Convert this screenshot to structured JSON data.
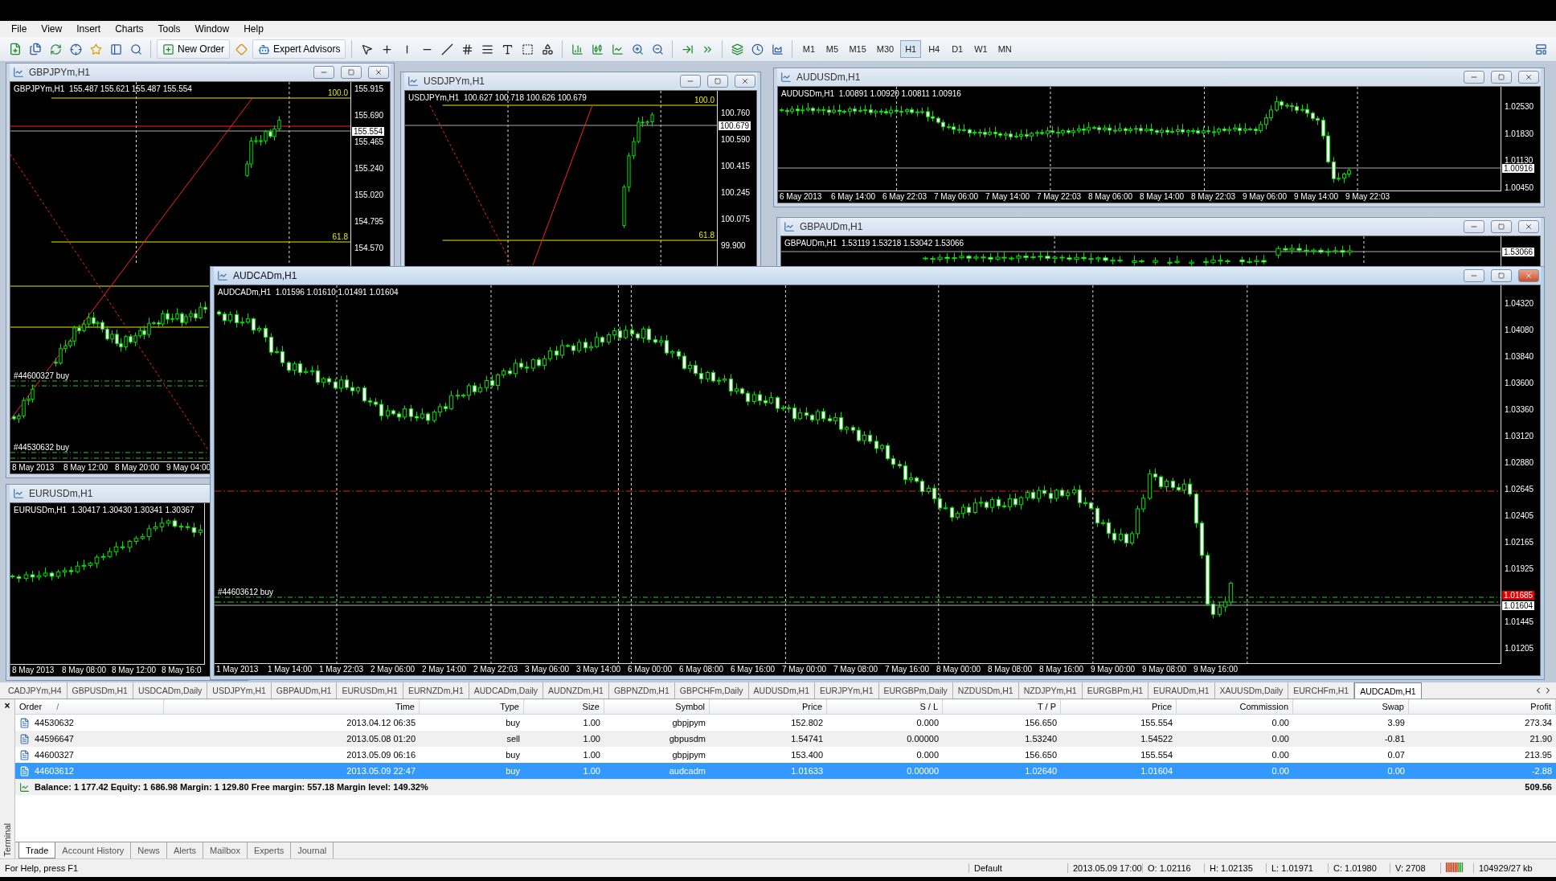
{
  "menu": [
    "File",
    "View",
    "Insert",
    "Charts",
    "Tools",
    "Window",
    "Help"
  ],
  "toolbar": {
    "buttons": [
      "New Order",
      "Expert Advisors"
    ],
    "timeframes": [
      {
        "label": "M1",
        "selected": false
      },
      {
        "label": "M5",
        "selected": false
      },
      {
        "label": "M15",
        "selected": false
      },
      {
        "label": "M30",
        "selected": false
      },
      {
        "label": "H1",
        "selected": true
      },
      {
        "label": "H4",
        "selected": false
      },
      {
        "label": "D1",
        "selected": false
      },
      {
        "label": "W1",
        "selected": false
      },
      {
        "label": "MN",
        "selected": false
      }
    ]
  },
  "windows": [
    {
      "title": "GBPJPYm,H1",
      "active": false,
      "header": "GBPJPYm,H1  155.487 155.621 155.487 155.554",
      "y_labels": [
        {
          "text": "155.915",
          "kind": "tick"
        },
        {
          "text": "155.690",
          "kind": "tick"
        },
        {
          "text": "155.554",
          "kind": "current"
        },
        {
          "text": "155.465",
          "kind": "tick"
        },
        {
          "text": "155.240",
          "kind": "tick"
        },
        {
          "text": "155.020",
          "kind": "tick"
        },
        {
          "text": "154.795",
          "kind": "tick"
        },
        {
          "text": "154.570",
          "kind": "tick"
        }
      ],
      "x_labels": [
        "8 May 2013",
        "8 May 12:00",
        "8 May 20:00",
        "9 May 04:00"
      ],
      "marks": [
        {
          "kind": "fib",
          "label": "100.0"
        },
        {
          "kind": "fib",
          "label": "61.8"
        },
        {
          "kind": "trade",
          "label": "#44600327 buy"
        },
        {
          "kind": "trade",
          "label": "#44530632 buy"
        }
      ]
    },
    {
      "title": "USDJPYm,H1",
      "active": false,
      "header": "USDJPYm,H1  100.627 100.718 100.626 100.679",
      "y_labels": [
        {
          "text": "100.760",
          "kind": "tick"
        },
        {
          "text": "100.679",
          "kind": "current"
        },
        {
          "text": "100.590",
          "kind": "tick"
        },
        {
          "text": "100.415",
          "kind": "tick"
        },
        {
          "text": "100.245",
          "kind": "tick"
        },
        {
          "text": "100.075",
          "kind": "tick"
        },
        {
          "text": "99.900",
          "kind": "tick"
        }
      ],
      "marks": [
        {
          "kind": "fib",
          "label": "100.0"
        },
        {
          "kind": "fib",
          "label": "61.8"
        }
      ]
    },
    {
      "title": "AUDUSDm,H1",
      "active": false,
      "header": "AUDUSDm,H1  1.00891 1.00920 1.00811 1.00916",
      "y_labels": [
        {
          "text": "1.02530",
          "kind": "tick"
        },
        {
          "text": "1.01830",
          "kind": "tick"
        },
        {
          "text": "1.01130",
          "kind": "tick"
        },
        {
          "text": "1.00916",
          "kind": "current"
        },
        {
          "text": "1.00450",
          "kind": "tick"
        }
      ],
      "x_labels": [
        "6 May 2013",
        "6 May 14:00",
        "6 May 22:03",
        "7 May 06:00",
        "7 May 14:00",
        "7 May 22:03",
        "8 May 06:00",
        "8 May 14:00",
        "8 May 22:03",
        "9 May 06:00",
        "9 May 14:00",
        "9 May 22:03"
      ]
    },
    {
      "title": "GBPAUDm,H1",
      "active": false,
      "header": "GBPAUDm,H1  1.53119 1.53218 1.53042 1.53066",
      "y_labels": [
        {
          "text": "1.53066",
          "kind": "current"
        }
      ]
    },
    {
      "title": "EURUSDm,H1",
      "active": false,
      "header": "EURUSDm,H1  1.30417 1.30430 1.30341 1.30367",
      "x_labels": [
        "8 May 2013",
        "8 May 08:00",
        "8 May 12:00",
        "8 May 16:0"
      ]
    },
    {
      "title": "AUDCADm,H1",
      "active": true,
      "header": "AUDCADm,H1  1.01596 1.01610 1.01491 1.01604",
      "y_labels": [
        {
          "text": "1.04320",
          "kind": "tick"
        },
        {
          "text": "1.04080",
          "kind": "tick"
        },
        {
          "text": "1.03840",
          "kind": "tick"
        },
        {
          "text": "1.03600",
          "kind": "tick"
        },
        {
          "text": "1.03360",
          "kind": "tick"
        },
        {
          "text": "1.03120",
          "kind": "tick"
        },
        {
          "text": "1.02880",
          "kind": "tick"
        },
        {
          "text": "1.02645",
          "kind": "tick"
        },
        {
          "text": "1.02405",
          "kind": "tick"
        },
        {
          "text": "1.02165",
          "kind": "tick"
        },
        {
          "text": "1.01925",
          "kind": "tick"
        },
        {
          "text": "1.01685",
          "kind": "stop"
        },
        {
          "text": "1.01604",
          "kind": "current"
        },
        {
          "text": "1.01445",
          "kind": "tick"
        },
        {
          "text": "1.01205",
          "kind": "tick"
        }
      ],
      "x_labels": [
        "1 May 2013",
        "1 May 14:00",
        "1 May 22:03",
        "2 May 06:00",
        "2 May 14:00",
        "2 May 22:03",
        "3 May 06:00",
        "3 May 14:00",
        "6 May 00:00",
        "6 May 08:00",
        "6 May 16:00",
        "7 May 00:00",
        "7 May 08:00",
        "7 May 16:00",
        "8 May 00:00",
        "8 May 08:00",
        "8 May 16:00",
        "9 May 00:00",
        "9 May 08:00",
        "9 May 16:00"
      ],
      "marks": [
        {
          "kind": "trade",
          "label": "#44603612 buy"
        }
      ]
    }
  ],
  "chart_tabs": [
    {
      "label": "CADJPYm,H4",
      "selected": false
    },
    {
      "label": "GBPUSDm,H1",
      "selected": false
    },
    {
      "label": "USDCADm,Daily",
      "selected": false
    },
    {
      "label": "USDJPYm,H1",
      "selected": false
    },
    {
      "label": "GBPAUDm,H1",
      "selected": false
    },
    {
      "label": "EURUSDm,H1",
      "selected": false
    },
    {
      "label": "EURNZDm,H1",
      "selected": false
    },
    {
      "label": "AUDCADm,Daily",
      "selected": false
    },
    {
      "label": "AUDNZDm,H1",
      "selected": false
    },
    {
      "label": "GBPNZDm,H1",
      "selected": false
    },
    {
      "label": "GBPCHFm,Daily",
      "selected": false
    },
    {
      "label": "AUDUSDm,H1",
      "selected": false
    },
    {
      "label": "EURJPYm,H1",
      "selected": false
    },
    {
      "label": "EURGBPm,Daily",
      "selected": false
    },
    {
      "label": "NZDUSDm,H1",
      "selected": false
    },
    {
      "label": "NZDJPYm,H1",
      "selected": false
    },
    {
      "label": "EURGBPm,H1",
      "selected": false
    },
    {
      "label": "EURAUDm,H1",
      "selected": false
    },
    {
      "label": "XAUUSDm,Daily",
      "selected": false
    },
    {
      "label": "EURCHFm,H1",
      "selected": false
    },
    {
      "label": "AUDCADm,H1",
      "selected": true
    }
  ],
  "terminal": {
    "title": "Terminal",
    "close": "×",
    "sort_indicator": "/",
    "columns": [
      "Order",
      "Time",
      "Type",
      "Size",
      "Symbol",
      "Price",
      "S / L",
      "T / P",
      "Price",
      "Commission",
      "Swap",
      "Profit"
    ],
    "rows": [
      {
        "selected": false,
        "cells": [
          "44530632",
          "2013.04.12 06:35",
          "buy",
          "1.00",
          "gbpjpym",
          "152.802",
          "0.000",
          "156.650",
          "155.554",
          "0.00",
          "3.99",
          "273.34"
        ]
      },
      {
        "selected": false,
        "cells": [
          "44596647",
          "2013.05.08 01:20",
          "sell",
          "1.00",
          "gbpusdm",
          "1.54741",
          "0.00000",
          "1.53240",
          "1.54522",
          "0.00",
          "-0.81",
          "21.90"
        ]
      },
      {
        "selected": false,
        "cells": [
          "44600327",
          "2013.05.09 06:16",
          "buy",
          "1.00",
          "gbpjpym",
          "153.400",
          "0.000",
          "156.650",
          "155.554",
          "0.00",
          "0.07",
          "213.95"
        ]
      },
      {
        "selected": true,
        "cells": [
          "44603612",
          "2013.05.09 22:47",
          "buy",
          "1.00",
          "audcadm",
          "1.01633",
          "0.00000",
          "1.02640",
          "1.01604",
          "0.00",
          "0.00",
          "-2.88"
        ]
      }
    ],
    "summary": {
      "text": "Balance: 1 177.42  Equity: 1 686.98  Margin: 1 129.80  Free margin: 557.18  Margin level: 149.32%",
      "profit": "509.56"
    },
    "tabs": [
      {
        "label": "Trade",
        "selected": true
      },
      {
        "label": "Account History",
        "selected": false
      },
      {
        "label": "News",
        "selected": false
      },
      {
        "label": "Alerts",
        "selected": false
      },
      {
        "label": "Mailbox",
        "selected": false
      },
      {
        "label": "Experts",
        "selected": false
      },
      {
        "label": "Journal",
        "selected": false
      }
    ]
  },
  "status_bar": {
    "help": "For Help, press F1",
    "profile": "Default",
    "time": "2013.05.09 17:00",
    "open": "O: 1.02116",
    "high": "H: 1.02135",
    "low": "L: 1.01971",
    "close": "C: 1.01980",
    "volume": "V: 2708",
    "traffic": "104929/27 kb"
  }
}
